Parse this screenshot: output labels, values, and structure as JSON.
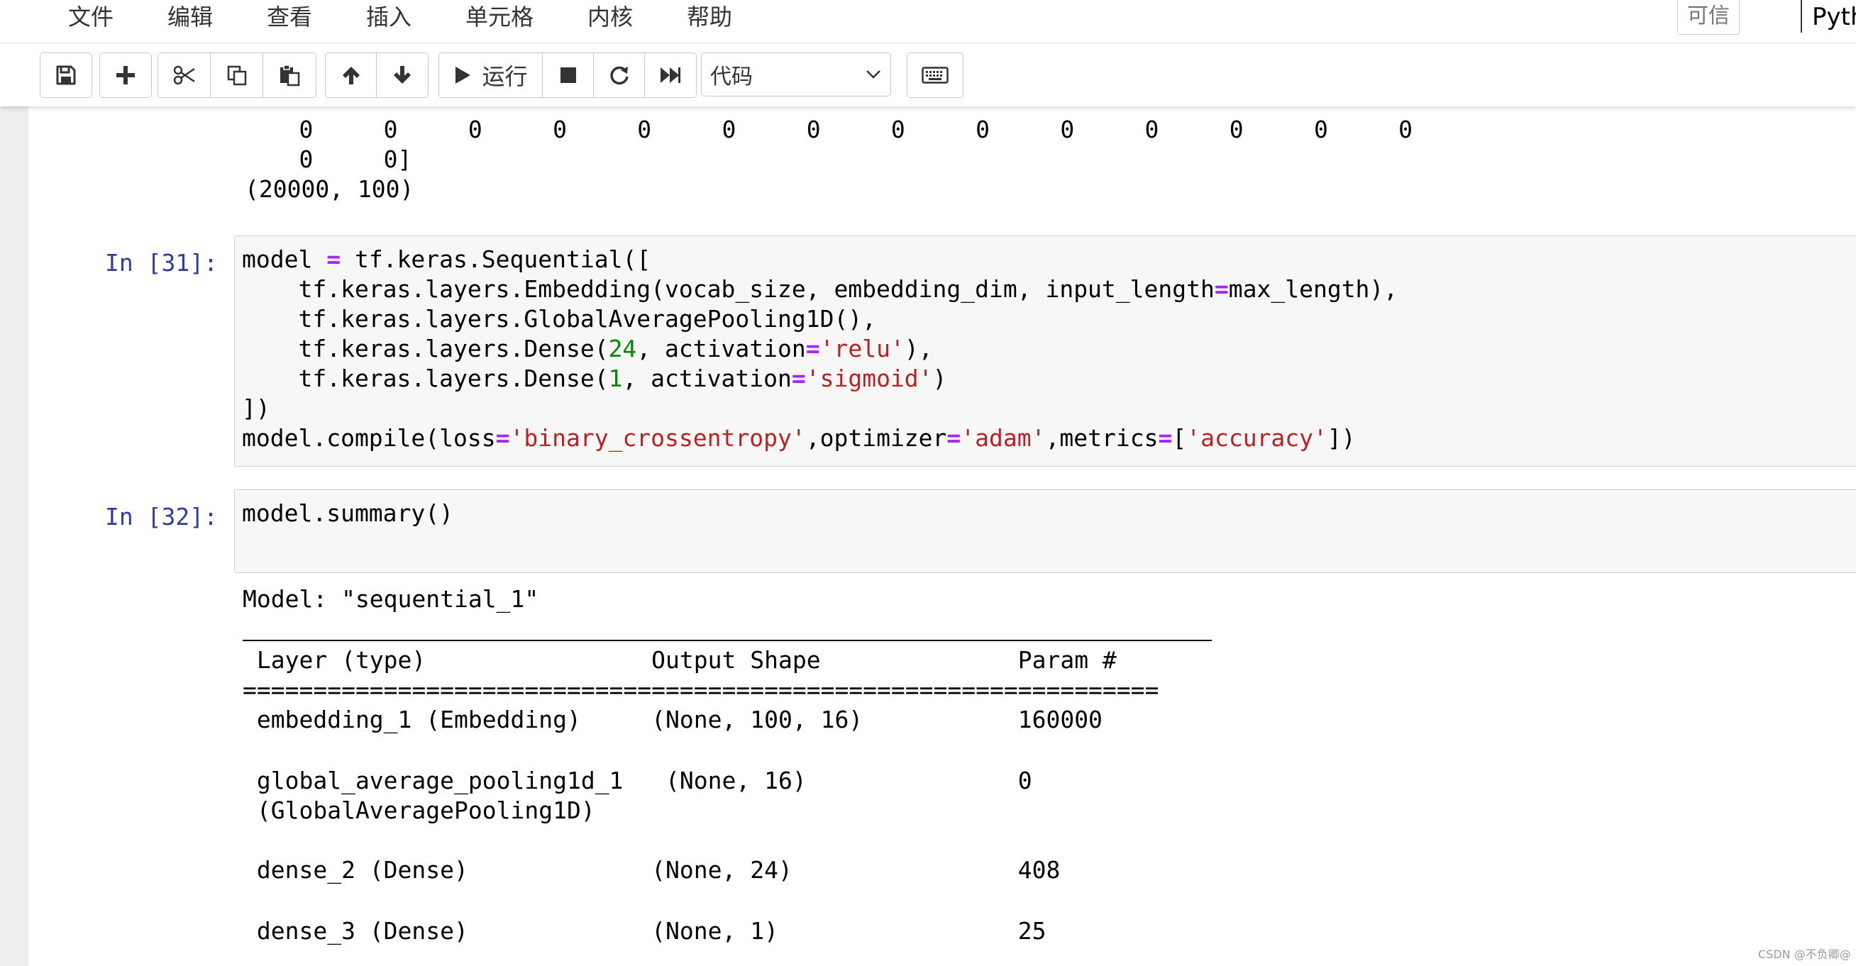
{
  "menu": {
    "file": "文件",
    "edit": "编辑",
    "view": "查看",
    "insert": "插入",
    "cell": "单元格",
    "kernel": "内核",
    "help": "帮助"
  },
  "trusted": "可信",
  "kernel_name": "Pyth",
  "toolbar": {
    "run_label": "运行",
    "cell_type": "代码",
    "icons": [
      "save-icon",
      "plus-icon",
      "scissors-icon",
      "copy-icon",
      "paste-icon",
      "arrow-up-icon",
      "arrow-down-icon",
      "play-icon",
      "stop-icon",
      "restart-icon",
      "fast-forward-icon",
      "chevron-down-icon",
      "keyboard-icon"
    ]
  },
  "prev_output": {
    "row1": "    0     0     0     0     0     0     0     0     0     0     0     0     0     0",
    "row2": "    0     0]",
    "shape": "(20000, 100)"
  },
  "cell31": {
    "prompt": "In [31]:",
    "lines": [
      "model = tf.keras.Sequential([",
      "    tf.keras.layers.Embedding(vocab_size, embedding_dim, input_length=max_length),",
      "    tf.keras.layers.GlobalAveragePooling1D(),",
      "    tf.keras.layers.Dense(24, activation='relu'),",
      "    tf.keras.layers.Dense(1, activation='sigmoid')",
      "])",
      "model.compile(loss='binary_crossentropy',optimizer='adam',metrics=['accuracy'])"
    ]
  },
  "cell32": {
    "prompt": "In [32]:",
    "code": "model.summary()"
  },
  "summary": {
    "model_line": "Model: \"sequential_1\"",
    "header": " Layer (type)                Output Shape              Param #   ",
    "equals": "=================================================================",
    "rows": [
      " embedding_1 (Embedding)     (None, 100, 16)           160000    ",
      " global_average_pooling1d_1   (None, 16)               0         ",
      " (GlobalAveragePooling1D)                                        ",
      " dense_2 (Dense)             (None, 24)                408       ",
      " dense_3 (Dense)             (None, 1)                 25        "
    ]
  },
  "watermark": "CSDN @不负卿@"
}
